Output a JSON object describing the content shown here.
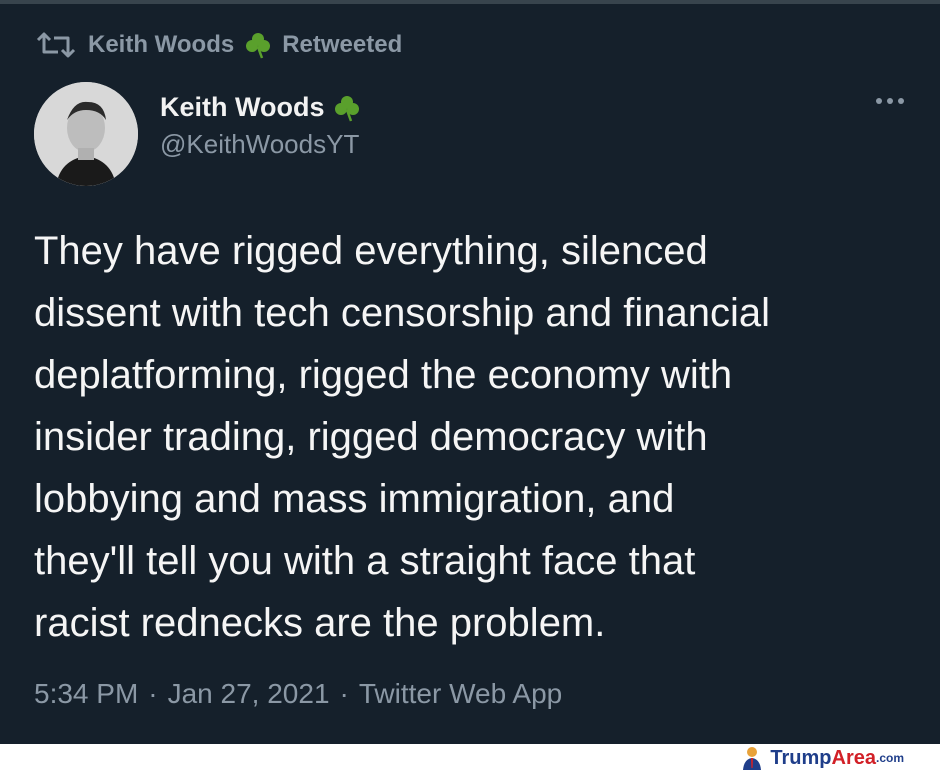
{
  "retweet": {
    "user": "Keith Woods",
    "label": "Retweeted",
    "icon": "retweet-icon"
  },
  "author": {
    "display_name": "Keith Woods",
    "handle": "@KeithWoodsYT",
    "badge_icon": "shamrock-icon",
    "avatar_icon": "avatar-photo"
  },
  "more_icon": "more-options-icon",
  "tweet": {
    "lines": [
      "They have rigged everything, silenced",
      "dissent with tech censorship and financial",
      "deplatforming, rigged the economy with",
      "insider trading, rigged democracy with",
      "lobbying and mass immigration, and",
      "they'll tell you with a straight face that",
      "racist rednecks are the problem."
    ]
  },
  "meta": {
    "time": "5:34 PM",
    "sep1": "·",
    "date": "Jan 27, 2021",
    "sep2": "·",
    "source": "Twitter Web App"
  },
  "watermark": {
    "part1": "Trump",
    "part2": "Area",
    "part3": ".com"
  },
  "colors": {
    "background": "#15202b",
    "text": "#f5f5f5",
    "secondary": "#8b98a5",
    "shamrock": "#5aa02c"
  }
}
